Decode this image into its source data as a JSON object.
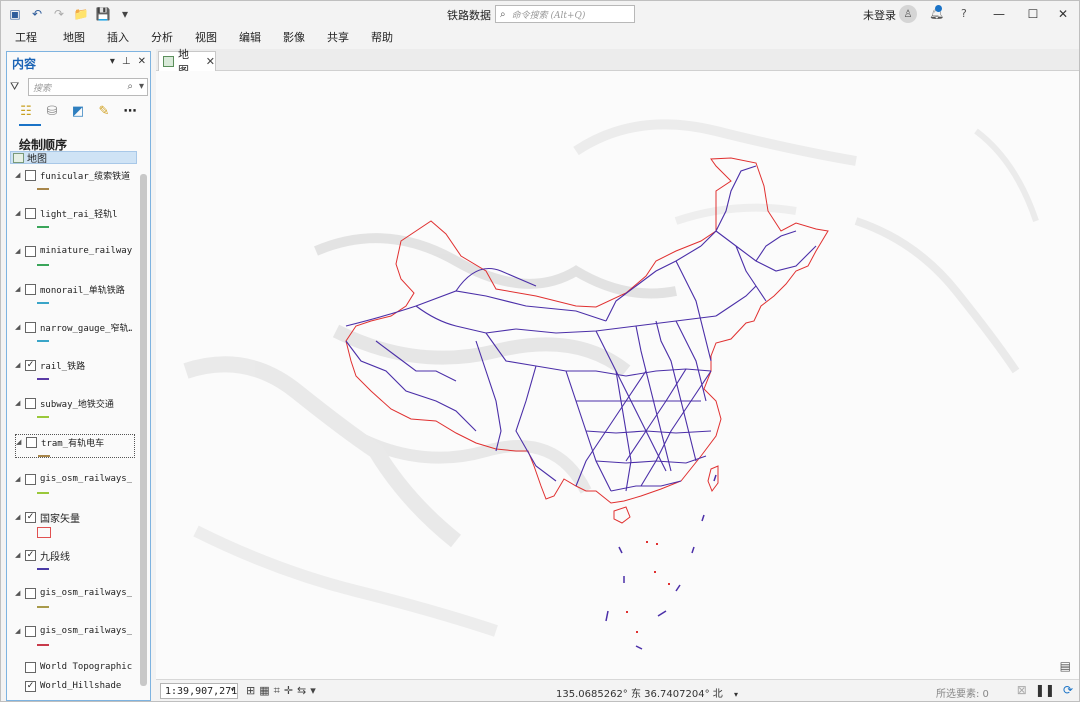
{
  "app": {
    "title": "铁路数据",
    "command_search_placeholder": "命令搜索 (Alt+Q)",
    "signin": "未登录",
    "help": "?"
  },
  "menu": [
    "工程",
    "地图",
    "插入",
    "分析",
    "视图",
    "编辑",
    "影像",
    "共享",
    "帮助"
  ],
  "contents": {
    "title": "内容",
    "search_placeholder": "搜索",
    "draw_order_label": "绘制顺序",
    "map_node": "地图",
    "layers": [
      {
        "name": "funicular_缆索铁道",
        "checked": false,
        "symbol": "line",
        "color": "#a8864a"
      },
      {
        "name": "light_rai_轻轨l",
        "checked": false,
        "symbol": "line",
        "color": "#3aa55a"
      },
      {
        "name": "miniature_railway…",
        "checked": false,
        "symbol": "line",
        "color": "#3aa55a"
      },
      {
        "name": "monorail_单轨铁路",
        "checked": false,
        "symbol": "line",
        "color": "#3aa5c8"
      },
      {
        "name": "narrow_gauge_窄轨…",
        "checked": false,
        "symbol": "line",
        "color": "#3aa5c8"
      },
      {
        "name": "rail_铁路",
        "checked": true,
        "symbol": "line",
        "color": "#5a3aa5"
      },
      {
        "name": "subway_地铁交通",
        "checked": false,
        "symbol": "line",
        "color": "#9ac83a"
      },
      {
        "name": "tram_有轨电车",
        "checked": false,
        "symbol": "line",
        "color": "#a8864a"
      },
      {
        "name": "gis_osm_railways_…",
        "checked": false,
        "symbol": "line",
        "color": "#9ac83a"
      },
      {
        "name": "国家矢量",
        "checked": true,
        "symbol": "box",
        "color": "#e05050"
      },
      {
        "name": "九段线",
        "checked": true,
        "symbol": "line",
        "color": "#4a3aa5"
      },
      {
        "name": "gis_osm_railways_…",
        "checked": false,
        "symbol": "line",
        "color": "#a89a4a"
      },
      {
        "name": "gis_osm_railways_…",
        "checked": false,
        "symbol": "line",
        "color": "#c83a4a"
      },
      {
        "name": "World Topographic…",
        "checked": false,
        "symbol": "none",
        "color": ""
      },
      {
        "name": "World_Hillshade",
        "checked": true,
        "symbol": "none",
        "color": ""
      }
    ]
  },
  "map": {
    "tab_label": "地图",
    "boundary_color": "#e03030",
    "rail_color": "#4b2fa8"
  },
  "status": {
    "scale": "1:39,907,271",
    "coordinates": "135.0685262° 东  36.7407204° 北",
    "selected_features": "所选要素: 0"
  }
}
